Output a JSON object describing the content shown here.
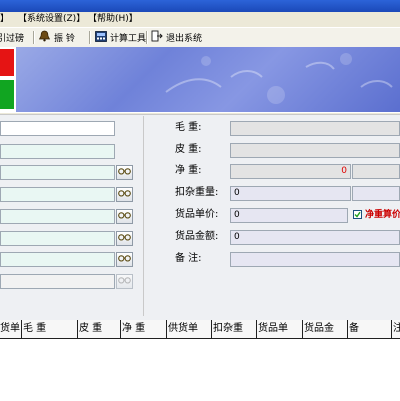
{
  "menu": {
    "item1": "】",
    "item2": "【系统设置(Z)】",
    "item3": "【帮助(H)】"
  },
  "toolbar": {
    "guide_label": "牵引过磅",
    "bell_label": "振 铃",
    "calc_label": "计算工具",
    "exit_label": "退出系统"
  },
  "form": {
    "gross_label": "毛 重:",
    "tare_label": "皮 重:",
    "net_label": "净 重:",
    "net_value": "0",
    "deduct_label": "扣杂重量:",
    "deduct_value": "0",
    "price_label": "货品单价:",
    "price_value": "0",
    "net_price_label": "净重算价",
    "amount_label": "货品金额:",
    "amount_value": "0",
    "remark_label": "备 注:"
  },
  "grid": {
    "columns": [
      "货单",
      "毛 重",
      "皮 重",
      "净 重",
      "供货单",
      "扣杂重",
      "货品单",
      "货品金",
      "备",
      "注"
    ]
  },
  "colors": {
    "light_red": "#e51414",
    "light_green": "#11a521",
    "net_value_red": "#e00000",
    "checkbox_red": "#cc0000"
  }
}
